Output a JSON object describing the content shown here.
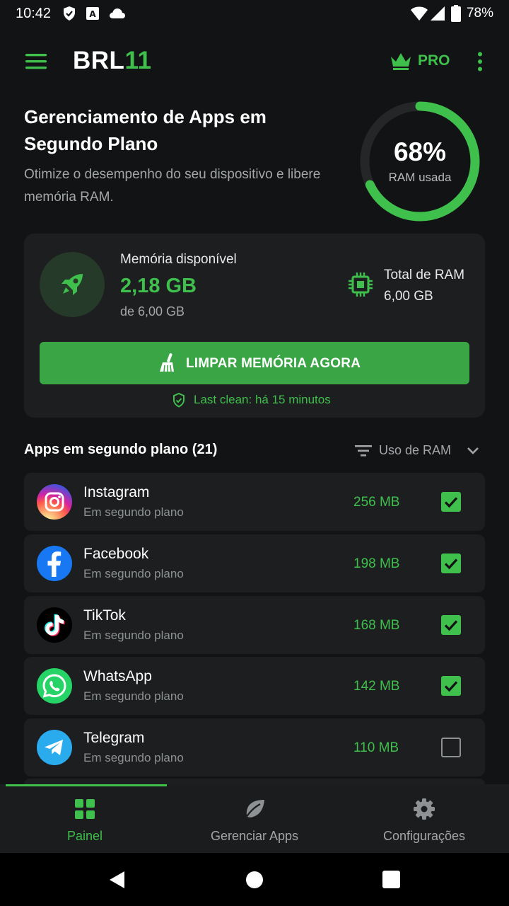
{
  "status_bar": {
    "time": "10:42",
    "battery": "78%"
  },
  "app_bar": {
    "brand_main": "BRL",
    "brand_accent": "11",
    "pro_label": "PRO"
  },
  "hero": {
    "title": "Gerenciamento de Apps em Segundo Plano",
    "subtitle": "Otimize o desempenho do seu dispositivo e libere memória RAM.",
    "ram_percent_text": "68%",
    "ram_percent_value": 68,
    "ram_label": "RAM usada"
  },
  "memory_card": {
    "available_label": "Memória disponível",
    "available_value": "2,18 GB",
    "available_of": "de 6,00 GB",
    "total_label": "Total de RAM",
    "total_value": "6,00 GB",
    "clean_button": "LIMPAR MEMÓRIA AGORA",
    "last_clean": "Last clean: há 15 minutos"
  },
  "apps_section": {
    "title": "Apps em segundo plano (21)",
    "sort_label": "Uso de RAM"
  },
  "apps": [
    {
      "name": "Instagram",
      "state": "Em segundo plano",
      "mem": "256 MB",
      "checked": true
    },
    {
      "name": "Facebook",
      "state": "Em segundo plano",
      "mem": "198 MB",
      "checked": true
    },
    {
      "name": "TikTok",
      "state": "Em segundo plano",
      "mem": "168 MB",
      "checked": true
    },
    {
      "name": "WhatsApp",
      "state": "Em segundo plano",
      "mem": "142 MB",
      "checked": true
    },
    {
      "name": "Telegram",
      "state": "Em segundo plano",
      "mem": "110 MB",
      "checked": false
    }
  ],
  "bottom_nav": {
    "items": [
      {
        "label": "Painel",
        "active": true
      },
      {
        "label": "Gerenciar Apps",
        "active": false
      },
      {
        "label": "Configurações",
        "active": false
      }
    ]
  },
  "colors": {
    "accent": "#3fbf4c",
    "background": "#121314",
    "card": "#1c1e1f"
  }
}
